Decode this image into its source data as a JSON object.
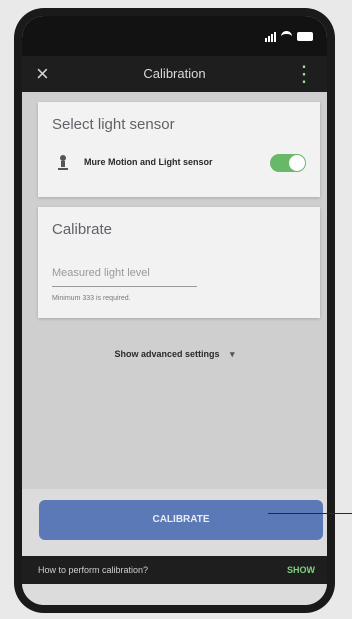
{
  "app_bar": {
    "title": "Calibration"
  },
  "sensor_card": {
    "title": "Select light sensor",
    "sensor_name": "Mure Motion and Light sensor",
    "toggle_on": true
  },
  "calibrate_card": {
    "title": "Calibrate",
    "field_placeholder": "Measured light level",
    "help_text": "Minimum 333 is required."
  },
  "advanced": {
    "label": "Show advanced settings"
  },
  "actions": {
    "calibrate_label": "CALIBRATE"
  },
  "bottom_bar": {
    "how_to": "How to perform calibration?",
    "show_label": "SHOW"
  },
  "colors": {
    "accent_blue": "#5b79b6",
    "toggle_green": "#67b868",
    "link_green": "#7fd07f"
  }
}
